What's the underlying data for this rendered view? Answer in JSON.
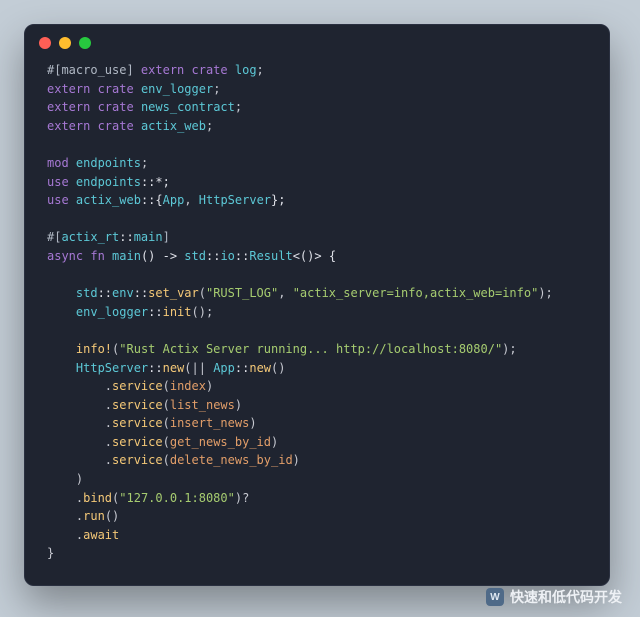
{
  "window": {
    "dots": [
      "red",
      "yellow",
      "green"
    ]
  },
  "code": {
    "l01_a": "#[macro_use]",
    "l01_b": " extern",
    "l01_c": " crate",
    "l01_d": " log",
    "l01_e": ";",
    "l02_a": "extern",
    "l02_b": " crate",
    "l02_c": " env_logger",
    "l02_d": ";",
    "l03_a": "extern",
    "l03_b": " crate",
    "l03_c": " news_contract",
    "l03_d": ";",
    "l04_a": "extern",
    "l04_b": " crate",
    "l04_c": " actix_web",
    "l04_d": ";",
    "blank1": "",
    "l05_a": "mod",
    "l05_b": " endpoints",
    "l05_c": ";",
    "l06_a": "use",
    "l06_b": " endpoints",
    "l06_c": "::*;",
    "l07_a": "use",
    "l07_b": " actix_web",
    "l07_c": "::{",
    "l07_d": "App",
    "l07_e": ", ",
    "l07_f": "HttpServer",
    "l07_g": "};",
    "blank2": "",
    "l08_a": "#[",
    "l08_b": "actix_rt",
    "l08_c": "::",
    "l08_d": "main",
    "l08_e": "]",
    "l09_a": "async",
    "l09_b": " fn",
    "l09_c": " main",
    "l09_d": "() -> ",
    "l09_e": "std",
    "l09_f": "::",
    "l09_g": "io",
    "l09_h": "::",
    "l09_i": "Result",
    "l09_j": "<()> {",
    "blank3": "",
    "l10_a": "    std",
    "l10_b": "::",
    "l10_c": "env",
    "l10_d": "::",
    "l10_e": "set_var",
    "l10_f": "(",
    "l10_g": "\"RUST_LOG\"",
    "l10_h": ", ",
    "l10_i": "\"actix_server=info,actix_web=info\"",
    "l10_j": ");",
    "l11_a": "    env_logger",
    "l11_b": "::",
    "l11_c": "init",
    "l11_d": "();",
    "blank4": "",
    "l12_a": "    info!",
    "l12_b": "(",
    "l12_c": "\"Rust Actix Server running... http://localhost:8080/\"",
    "l12_d": ");",
    "l13_a": "    HttpServer",
    "l13_b": "::",
    "l13_c": "new",
    "l13_d": "(|| ",
    "l13_e": "App",
    "l13_f": "::",
    "l13_g": "new",
    "l13_h": "()",
    "l14_a": "        .",
    "l14_b": "service",
    "l14_c": "(",
    "l14_d": "index",
    "l14_e": ")",
    "l15_a": "        .",
    "l15_b": "service",
    "l15_c": "(",
    "l15_d": "list_news",
    "l15_e": ")",
    "l16_a": "        .",
    "l16_b": "service",
    "l16_c": "(",
    "l16_d": "insert_news",
    "l16_e": ")",
    "l17_a": "        .",
    "l17_b": "service",
    "l17_c": "(",
    "l17_d": "get_news_by_id",
    "l17_e": ")",
    "l18_a": "        .",
    "l18_b": "service",
    "l18_c": "(",
    "l18_d": "delete_news_by_id",
    "l18_e": ")",
    "l19_a": "    )",
    "l20_a": "    .",
    "l20_b": "bind",
    "l20_c": "(",
    "l20_d": "\"127.0.0.1:8080\"",
    "l20_e": ")?",
    "l21_a": "    .",
    "l21_b": "run",
    "l21_c": "()",
    "l22_a": "    .",
    "l22_b": "await",
    "l23_a": "}"
  },
  "watermark": {
    "icon": "W",
    "text": "快速和低代码开发"
  }
}
